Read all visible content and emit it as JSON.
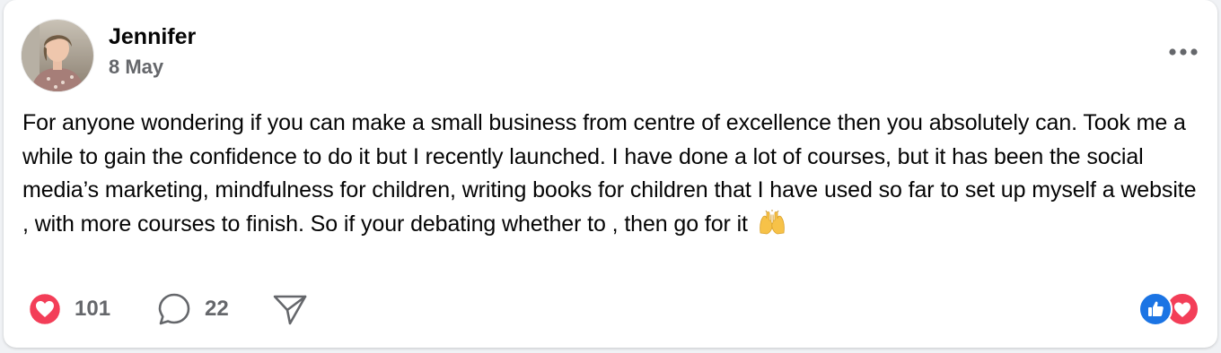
{
  "post": {
    "author": {
      "name": "Jennifer",
      "avatar_icon": "profile-photo"
    },
    "date": "8 May",
    "more_icon": "ellipsis-icon",
    "text": "For anyone wondering if you can make a small business from centre of excellence then you absolutely can. Took me a while to gain the confidence to do it but I recently launched. I have done a lot of courses, but it has been the social media’s marketing, mindfulness for children, writing books for children that I have used so far to set up myself a website , with more courses to finish. So if your debating whether to , then go for it",
    "emoji": "raising-hands-emoji"
  },
  "actions": {
    "love": {
      "icon": "heart-icon",
      "count": "101"
    },
    "comment": {
      "icon": "comment-bubble-icon",
      "count": "22"
    },
    "share": {
      "icon": "send-icon"
    }
  },
  "reactions": [
    "like-icon",
    "love-icon"
  ],
  "colors": {
    "love": "#f33e58",
    "like": "#1b74e4",
    "secondary_text": "#65676b",
    "primary_text": "#050505"
  }
}
